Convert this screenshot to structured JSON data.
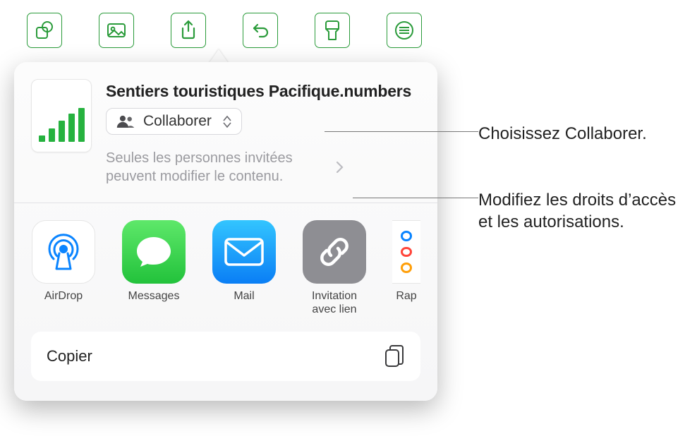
{
  "toolbar_icons": [
    "shapes-icon",
    "image-icon",
    "share-icon",
    "undo-icon",
    "brush-icon",
    "more-icon"
  ],
  "document": {
    "title": "Sentiers touristiques Pacifique.numbers"
  },
  "collaborate": {
    "label": "Collaborer",
    "permission_text": "Seules les personnes invitées peuvent modifier le contenu."
  },
  "apps": {
    "airdrop": "AirDrop",
    "messages": "Messages",
    "mail": "Mail",
    "link": "Invitation avec lien",
    "reminders": "Rap"
  },
  "actions": {
    "copy": "Copier"
  },
  "callouts": {
    "choose_collab": "Choisissez Collaborer.",
    "change_perms": "Modifiez les droits d’accès et les autorisations."
  }
}
